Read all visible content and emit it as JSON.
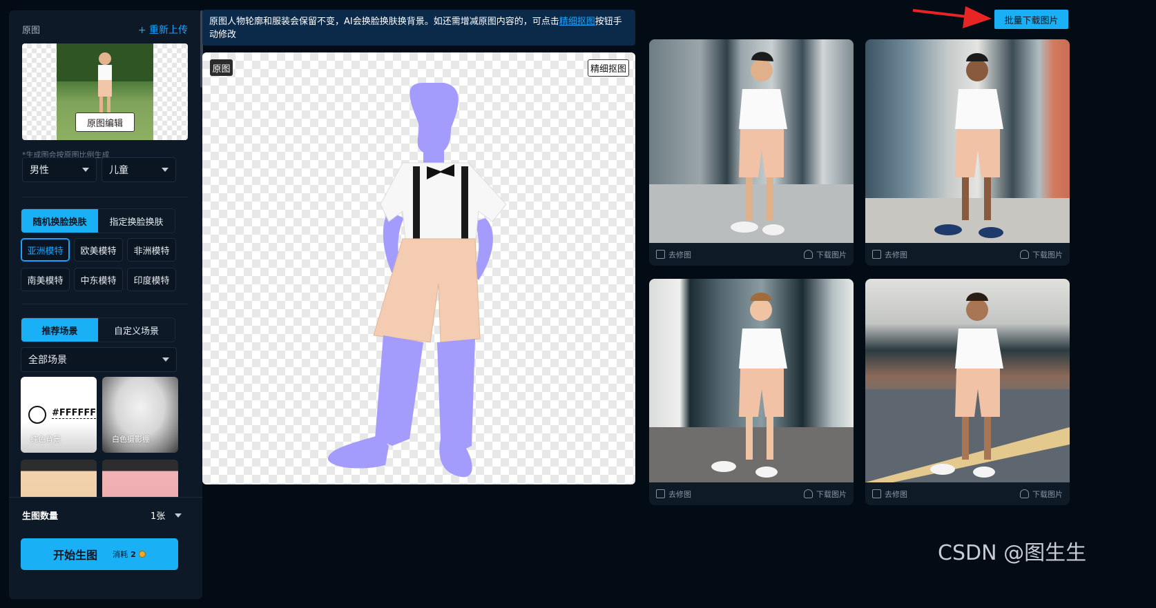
{
  "left": {
    "orig_label": "原图",
    "reupload": "+ 重新上传",
    "orig_edit": "原图编辑",
    "note": "*生成图会按原图比例生成",
    "gender": "男性",
    "age": "儿童",
    "face_tabs": [
      "随机换脸换肤",
      "指定换脸换肤"
    ],
    "models": [
      "亚洲模特",
      "欧美模特",
      "非洲模特",
      "南美模特",
      "中东模特",
      "印度模特"
    ],
    "scene_tabs": [
      "推荐场景",
      "自定义场景"
    ],
    "scene_filter": "全部场景",
    "scenes": [
      {
        "label": "纯色背景",
        "hex": "#FFFFFF"
      },
      {
        "label": "白色摄影棚"
      }
    ],
    "qty_label": "生图数量",
    "qty_value": "1张",
    "start": "开始生图",
    "cost_label": "消耗",
    "cost_value": "2"
  },
  "banner": {
    "text_before": "原图人物轮廓和服装会保留不变，AI会换脸换肤换背景。如还需增减原图内容的，可点击",
    "link": "精细抠图",
    "text_after": "按钮手动修改"
  },
  "canvas": {
    "tag_orig": "原图",
    "tag_refine": "精细抠图",
    "silhouette_color": "#a49cfd"
  },
  "results": {
    "batch_download": "批量下载图片",
    "retouch": "去修图",
    "download": "下载图片"
  },
  "watermark": "CSDN @图生生",
  "colors": {
    "accent": "#1ab0f5",
    "link": "#1aa3ff",
    "panel": "#0d1927",
    "bg": "#030b15"
  }
}
